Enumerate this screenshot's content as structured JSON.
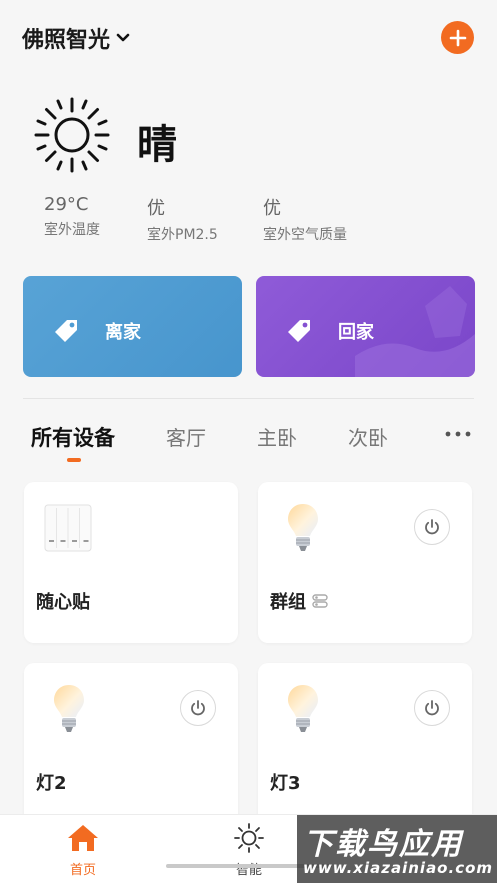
{
  "header": {
    "home_name": "佛照智光",
    "icons": {
      "dropdown": "chevron-down-icon",
      "add": "plus-icon"
    },
    "accent_color": "#f26b21"
  },
  "weather": {
    "icon": "sun-icon",
    "condition": "晴",
    "metrics": [
      {
        "value": "29°C",
        "label": "室外温度"
      },
      {
        "value": "优",
        "label": "室外PM2.5"
      },
      {
        "value": "优",
        "label": "室外空气质量"
      }
    ]
  },
  "scenes": [
    {
      "label": "离家",
      "icon": "tag-icon",
      "color": "#4f9cd3"
    },
    {
      "label": "回家",
      "icon": "tag-icon",
      "color": "#8551d1"
    }
  ],
  "rooms": {
    "tabs": [
      "所有设备",
      "客厅",
      "主卧",
      "次卧"
    ],
    "active": "所有设备",
    "more_icon": "more-horizontal-icon"
  },
  "devices": [
    {
      "name": "随心贴",
      "icon": "switch-panel-icon",
      "has_power": false
    },
    {
      "name": "群组",
      "icon": "bulb-icon",
      "has_power": true,
      "badge_icon": "group-icon"
    },
    {
      "name": "灯2",
      "icon": "bulb-icon",
      "has_power": true
    },
    {
      "name": "灯3",
      "icon": "bulb-icon",
      "has_power": true
    }
  ],
  "tabbar": {
    "items": [
      {
        "label": "首页",
        "icon": "home-icon",
        "active": true
      },
      {
        "label": "智能",
        "icon": "sun-outline-icon",
        "active": false
      }
    ]
  },
  "watermark": {
    "title": "下载鸟应用",
    "url": "www.xiazainiao.com"
  }
}
